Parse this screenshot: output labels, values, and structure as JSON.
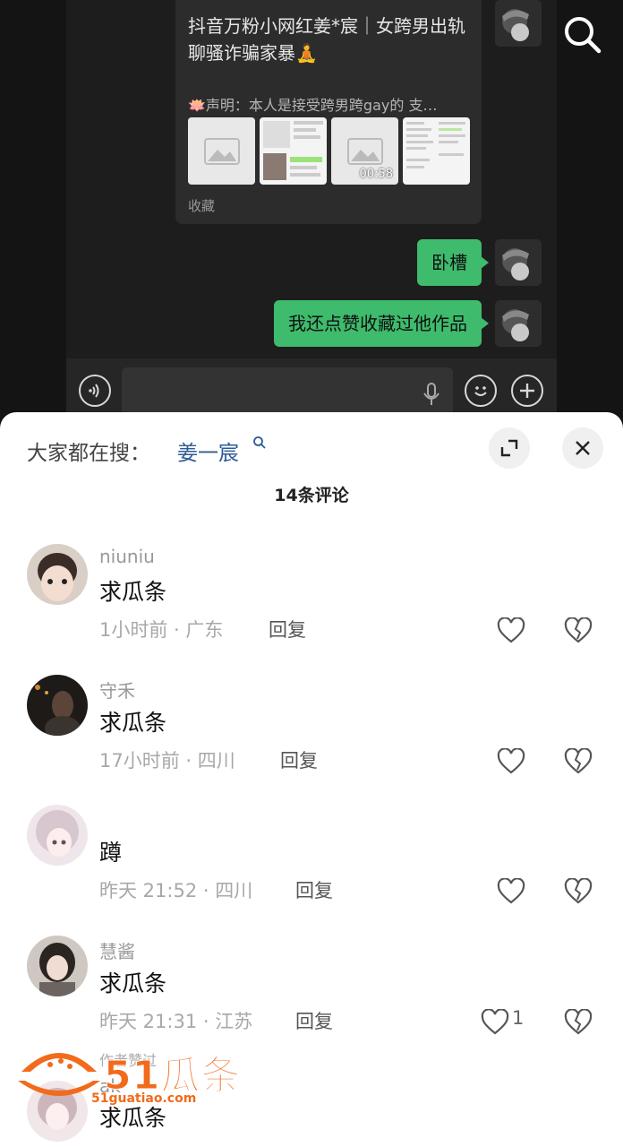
{
  "chat": {
    "share_card": {
      "title": "抖音万粉小网红姜*宸｜女跨男出轨聊骚诈骗家暴🧘",
      "description": "🪷声明：本人是接受跨男跨gay的 支…",
      "video_duration": "00:58",
      "footer": "收藏"
    },
    "messages": [
      {
        "text": "卧槽"
      },
      {
        "text": "我还点赞收藏过他作品"
      }
    ]
  },
  "sheet": {
    "search_label": "大家都在搜：",
    "search_term": "姜一宸",
    "comment_count": "14条评论",
    "comments": [
      {
        "name": "niuniu",
        "text": "求瓜条",
        "time": "1小时前",
        "location": "广东",
        "reply": "回复",
        "likes": ""
      },
      {
        "name": "守禾",
        "text": "求瓜条",
        "time": "17小时前",
        "location": "四川",
        "reply": "回复",
        "likes": ""
      },
      {
        "name": "",
        "text": "蹲",
        "time": "昨天 21:52",
        "location": "四川",
        "reply": "回复",
        "likes": ""
      },
      {
        "name": "慧酱",
        "text": "求瓜条",
        "time": "昨天 21:31",
        "location": "江苏",
        "reply": "回复",
        "likes": "1"
      },
      {
        "name": "ak",
        "badge": "作者赞过",
        "text": "求瓜条",
        "time": "",
        "location": "",
        "reply": "",
        "likes": ""
      }
    ]
  },
  "watermark": {
    "brand": "51瓜条",
    "url": "51guatiao.com"
  },
  "colors": {
    "bubble_green": "#3ebb6c",
    "search_term_blue": "#2d5b94",
    "watermark_orange": "#f26a1b"
  }
}
